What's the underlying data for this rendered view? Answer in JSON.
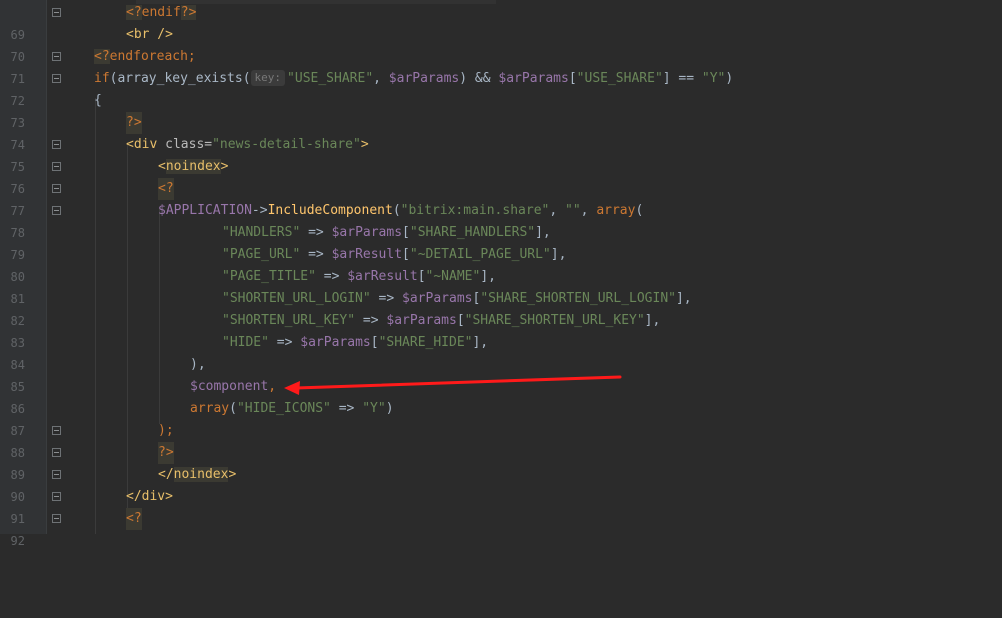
{
  "editor": {
    "hint_key": "key:",
    "accent_color": "#ff1a1a",
    "lines": [
      {
        "n": "69"
      },
      {
        "n": "70"
      },
      {
        "n": "71"
      },
      {
        "n": "72"
      },
      {
        "n": "73"
      },
      {
        "n": "74"
      },
      {
        "n": "75"
      },
      {
        "n": "76"
      },
      {
        "n": "77"
      },
      {
        "n": "78"
      },
      {
        "n": "79"
      },
      {
        "n": "80"
      },
      {
        "n": "81"
      },
      {
        "n": "82"
      },
      {
        "n": "83"
      },
      {
        "n": "84"
      },
      {
        "n": "85"
      },
      {
        "n": "86"
      },
      {
        "n": "87"
      },
      {
        "n": "88"
      },
      {
        "n": "89"
      },
      {
        "n": "90"
      },
      {
        "n": "91"
      },
      {
        "n": "92"
      }
    ],
    "code": {
      "l69_a": "<?",
      "l69_b": "endif",
      "l69_c": "?>",
      "l70": "<br />",
      "l71_a": "<?",
      "l71_b": "endforeach;",
      "l72_a": "if",
      "l72_b": "(array_key_exists(",
      "l72_c": "\"USE_SHARE\"",
      "l72_d": ", ",
      "l72_e": "$arParams",
      "l72_f": ") && ",
      "l72_g": "$arParams",
      "l72_h": "[",
      "l72_i": "\"USE_SHARE\"",
      "l72_j": "] == ",
      "l72_k": "\"Y\"",
      "l72_l": ")",
      "l73": "{",
      "l74": "?>",
      "l75_a": "<div ",
      "l75_b": "class=",
      "l75_c": "\"news-detail-share\"",
      "l75_d": ">",
      "l76_a": "<",
      "l76_b": "noindex",
      "l76_c": ">",
      "l77": "<?",
      "l78_a": "$APPLICATION",
      "l78_b": "->",
      "l78_c": "IncludeComponent",
      "l78_d": "(",
      "l78_e": "\"bitrix:main.share\"",
      "l78_f": ", ",
      "l78_g": "\"\"",
      "l78_h": ", ",
      "l78_i": "array",
      "l78_j": "(",
      "l79_a": "\"HANDLERS\"",
      "l79_b": " => ",
      "l79_c": "$arParams",
      "l79_d": "[",
      "l79_e": "\"SHARE_HANDLERS\"",
      "l79_f": "],",
      "l80_a": "\"PAGE_URL\"",
      "l80_b": " => ",
      "l80_c": "$arResult",
      "l80_d": "[",
      "l80_e": "\"~DETAIL_PAGE_URL\"",
      "l80_f": "],",
      "l81_a": "\"PAGE_TITLE\"",
      "l81_b": " => ",
      "l81_c": "$arResult",
      "l81_d": "[",
      "l81_e": "\"~NAME\"",
      "l81_f": "],",
      "l82_a": "\"SHORTEN_URL_LOGIN\"",
      "l82_b": " => ",
      "l82_c": "$arParams",
      "l82_d": "[",
      "l82_e": "\"SHARE_SHORTEN_URL_LOGIN\"",
      "l82_f": "],",
      "l83_a": "\"SHORTEN_URL_KEY\"",
      "l83_b": " => ",
      "l83_c": "$arParams",
      "l83_d": "[",
      "l83_e": "\"SHARE_SHORTEN_URL_KEY\"",
      "l83_f": "],",
      "l84_a": "\"HIDE\"",
      "l84_b": " => ",
      "l84_c": "$arParams",
      "l84_d": "[",
      "l84_e": "\"SHARE_HIDE\"",
      "l84_f": "],",
      "l85": "),",
      "l86_a": "$component",
      "l86_b": ",",
      "l87_a": "array",
      "l87_b": "(",
      "l87_c": "\"HIDE_ICONS\"",
      "l87_d": " => ",
      "l87_e": "\"Y\"",
      "l87_f": ")",
      "l88": ");",
      "l89": "?>",
      "l90_a": "</",
      "l90_b": "noindex",
      "l90_c": ">",
      "l91": "</div>",
      "l92": "<?"
    }
  }
}
